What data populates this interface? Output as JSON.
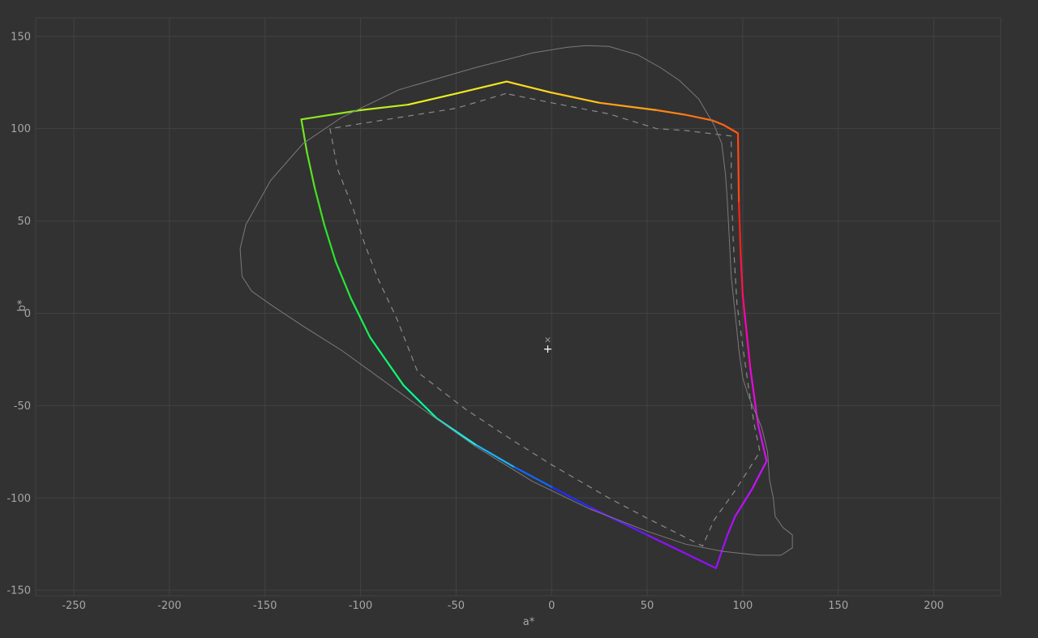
{
  "chart_data": {
    "type": "line",
    "title": "",
    "xlabel": "a*",
    "ylabel": "b*",
    "xlim": [
      -270,
      235
    ],
    "ylim": [
      -153,
      160
    ],
    "x_ticks": [
      -250,
      -200,
      -150,
      -100,
      -50,
      0,
      50,
      100,
      150,
      200
    ],
    "y_ticks": [
      -150,
      -100,
      -50,
      0,
      50,
      100,
      150
    ],
    "grid": true,
    "colors": {
      "background": "#323232",
      "grid": "#424242",
      "tick_text": "#a6a6a6",
      "reference_line": "#7a7a7a"
    },
    "series": [
      {
        "style": "gamut-gradient",
        "points": [
          [
            -23.5,
            125.5
          ],
          [
            0,
            119.5
          ],
          [
            25,
            114
          ],
          [
            55,
            110
          ],
          [
            70,
            107.5
          ],
          [
            84,
            104.5
          ],
          [
            90,
            102
          ],
          [
            97.5,
            97.5
          ],
          [
            98,
            60
          ],
          [
            99,
            30
          ],
          [
            100,
            10
          ],
          [
            101,
            0
          ],
          [
            104,
            -30
          ],
          [
            108,
            -60
          ],
          [
            112.5,
            -80
          ],
          [
            105,
            -95
          ],
          [
            96,
            -110
          ],
          [
            92,
            -120
          ],
          [
            86,
            -138
          ],
          [
            50,
            -120
          ],
          [
            20,
            -105
          ],
          [
            0,
            -94
          ],
          [
            -20,
            -83
          ],
          [
            -40,
            -71
          ],
          [
            -60,
            -57
          ],
          [
            -77.5,
            -39
          ],
          [
            -95,
            -13
          ],
          [
            -105,
            8
          ],
          [
            -113,
            28
          ],
          [
            -119,
            48
          ],
          [
            -124,
            68
          ],
          [
            -128,
            87
          ],
          [
            -131,
            105
          ],
          [
            -100,
            110
          ],
          [
            -75,
            113
          ],
          [
            -50,
            119
          ],
          [
            -23.5,
            125.5
          ]
        ]
      },
      {
        "style": "dashed",
        "points": [
          [
            -24,
            119
          ],
          [
            -50,
            111
          ],
          [
            -80,
            106
          ],
          [
            -116,
            100
          ],
          [
            -112,
            78
          ],
          [
            -104,
            57
          ],
          [
            -98,
            38
          ],
          [
            -91,
            19
          ],
          [
            -81,
            -3
          ],
          [
            -70,
            -32
          ],
          [
            -45,
            -52
          ],
          [
            -20,
            -69
          ],
          [
            0,
            -82
          ],
          [
            30,
            -100
          ],
          [
            50,
            -111
          ],
          [
            79,
            -126
          ],
          [
            85,
            -112
          ],
          [
            96,
            -96
          ],
          [
            109,
            -75
          ],
          [
            106,
            -60
          ],
          [
            103,
            -40
          ],
          [
            99,
            -10
          ],
          [
            97,
            5
          ],
          [
            95,
            40
          ],
          [
            94,
            70
          ],
          [
            94,
            96
          ],
          [
            70,
            99
          ],
          [
            55,
            100
          ],
          [
            30,
            108
          ],
          [
            0,
            114
          ],
          [
            -24,
            119
          ]
        ]
      },
      {
        "style": "thin-outline",
        "points": [
          [
            18,
            145
          ],
          [
            8,
            144
          ],
          [
            -10,
            141
          ],
          [
            -40,
            133
          ],
          [
            -80,
            121
          ],
          [
            -110,
            106
          ],
          [
            -130,
            92
          ],
          [
            -147,
            72
          ],
          [
            -160,
            48
          ],
          [
            -163,
            35
          ],
          [
            -162,
            20
          ],
          [
            -157,
            12
          ],
          [
            -146,
            4
          ],
          [
            -130,
            -7
          ],
          [
            -110,
            -20
          ],
          [
            -90,
            -35
          ],
          [
            -70,
            -50
          ],
          [
            -40,
            -72
          ],
          [
            -10,
            -91
          ],
          [
            20,
            -106
          ],
          [
            50,
            -118
          ],
          [
            70,
            -125
          ],
          [
            90,
            -129
          ],
          [
            108,
            -131
          ],
          [
            120,
            -131
          ],
          [
            126,
            -127
          ],
          [
            126,
            -120
          ],
          [
            121,
            -116
          ],
          [
            117,
            -110
          ],
          [
            116,
            -100
          ],
          [
            114,
            -90
          ],
          [
            113,
            -75
          ],
          [
            110,
            -62
          ],
          [
            106,
            -52
          ],
          [
            103,
            -45
          ],
          [
            100,
            -35
          ],
          [
            98,
            -20
          ],
          [
            96,
            0
          ],
          [
            94,
            20
          ],
          [
            93,
            40
          ],
          [
            92,
            60
          ],
          [
            91,
            75
          ],
          [
            89,
            92
          ],
          [
            85,
            102
          ],
          [
            77,
            116
          ],
          [
            67,
            126
          ],
          [
            57,
            133
          ],
          [
            45,
            140
          ],
          [
            30,
            144.5
          ],
          [
            18,
            145
          ]
        ]
      }
    ],
    "markers": [
      {
        "name": "white-point-cross",
        "symbol": "×",
        "x": -2,
        "y": -14
      },
      {
        "name": "white-point-plus",
        "symbol": "+",
        "x": -2,
        "y": -19.5
      }
    ]
  }
}
